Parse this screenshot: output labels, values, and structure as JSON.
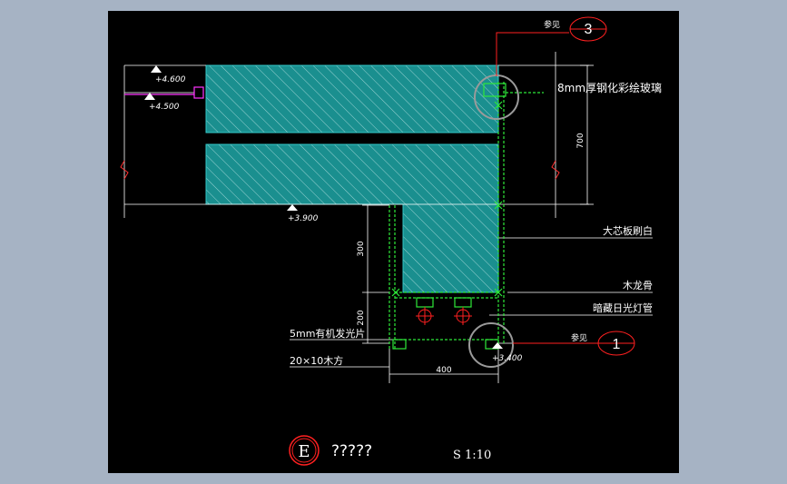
{
  "elevations": {
    "e1": "+4.600",
    "e2": "+4.500",
    "e3": "+3.900",
    "e4": "+3.400"
  },
  "dimensions": {
    "d700": "700",
    "d300": "300",
    "d200": "200",
    "d400": "400"
  },
  "callouts": {
    "ref_top_label": "参见",
    "ref_top_number": "3",
    "ref_bottom_label": "参见",
    "ref_bottom_number": "1",
    "glass": "8mm厚钢化彩绘玻璃",
    "board": "大芯板刷白",
    "keel": "木龙骨",
    "lamp": "暗藏日光灯管",
    "panel": "5mm有机发光片",
    "batten": "20×10木方"
  },
  "title_block": {
    "detail_letter": "E",
    "detail_name": "?????",
    "scale": "S 1:10"
  },
  "colors": {
    "background": "#a6b3c4",
    "canvas": "#000000",
    "concrete": "#1f9c9c",
    "green": "#2ee83a",
    "red": "#ff2020",
    "magenta": "#ff33ff",
    "white": "#ffffff",
    "circle_grey": "#9a9a9a"
  }
}
